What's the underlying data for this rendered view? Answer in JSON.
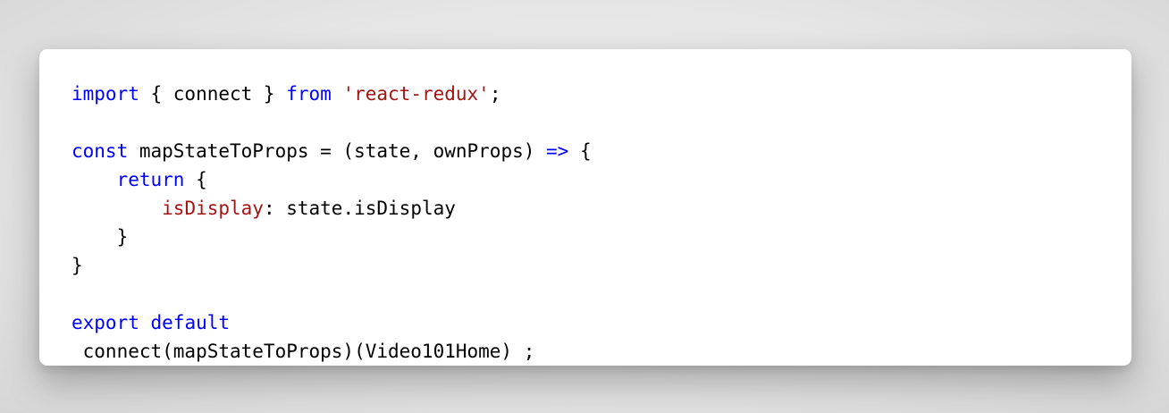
{
  "code": {
    "lines": [
      [
        {
          "t": "import",
          "c": "kw"
        },
        {
          "t": " { connect } ",
          "c": "plain"
        },
        {
          "t": "from",
          "c": "kw"
        },
        {
          "t": " ",
          "c": "plain"
        },
        {
          "t": "'react-redux'",
          "c": "str"
        },
        {
          "t": ";",
          "c": "plain"
        }
      ],
      [],
      [
        {
          "t": "const",
          "c": "kw"
        },
        {
          "t": " mapStateToProps = (state, ownProps) ",
          "c": "plain"
        },
        {
          "t": "=>",
          "c": "kw"
        },
        {
          "t": " {",
          "c": "plain"
        }
      ],
      [
        {
          "t": "    ",
          "c": "plain"
        },
        {
          "t": "return",
          "c": "kw"
        },
        {
          "t": " {",
          "c": "plain"
        }
      ],
      [
        {
          "t": "        ",
          "c": "plain"
        },
        {
          "t": "isDisplay",
          "c": "prop"
        },
        {
          "t": ": state.isDisplay",
          "c": "plain"
        }
      ],
      [
        {
          "t": "    }",
          "c": "plain"
        }
      ],
      [
        {
          "t": "}",
          "c": "plain"
        }
      ],
      [],
      [
        {
          "t": "export",
          "c": "kw"
        },
        {
          "t": " ",
          "c": "plain"
        },
        {
          "t": "default",
          "c": "kw"
        }
      ],
      [
        {
          "t": " connect(mapStateToProps)(Video101Home) ;",
          "c": "plain"
        }
      ]
    ]
  },
  "colors": {
    "keyword": "#0000ff",
    "string": "#a31515",
    "property": "#a31515",
    "text": "#000000",
    "card_background": "#ffffff"
  }
}
